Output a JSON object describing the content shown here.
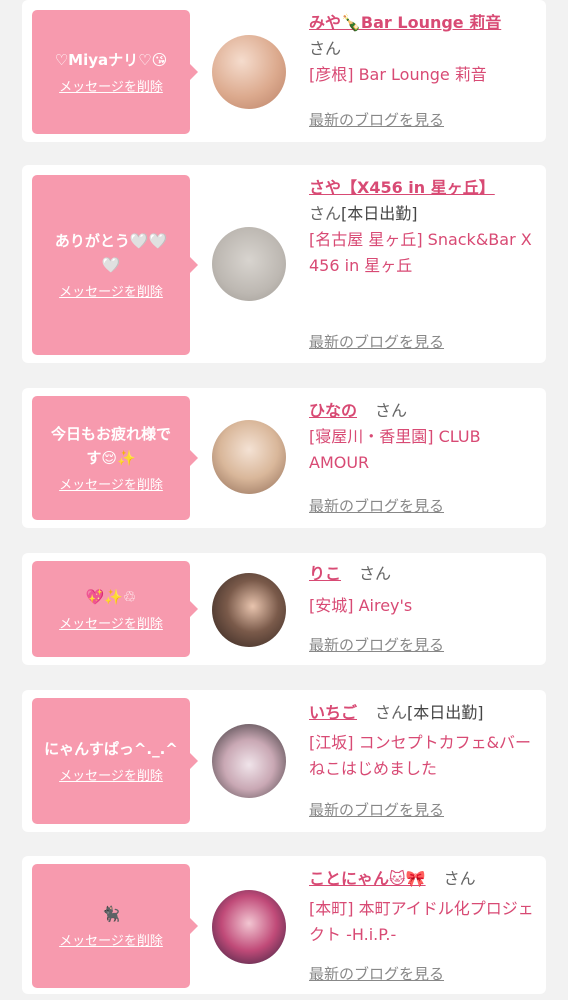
{
  "common": {
    "delete_label": "メッセージを削除",
    "blog_label": "最新のブログを見る",
    "san": "さん"
  },
  "messages": [
    {
      "bubble": "♡Miyaナリ♡😘",
      "name": "みや🍾Bar Lounge 莉音",
      "tag": "",
      "shop": "[彦根] Bar Lounge 莉音",
      "avatar_colors": [
        "#d8a48a",
        "#f1d3c3"
      ]
    },
    {
      "bubble": "ありがとう🤍🤍\n🤍",
      "name": "さや【X456 in 星ヶ丘】",
      "tag": "[本日出勤]",
      "shop": "[名古屋 星ヶ丘] Snack&Bar X 456 in 星ヶ丘",
      "avatar_colors": [
        "#cfcac4",
        "#a8a39d"
      ]
    },
    {
      "bubble": "今日もお疲れ様で\nす😌✨",
      "name": "ひなの",
      "tag": "",
      "shop": "[寝屋川・香里園] CLUB AMOUR",
      "avatar_colors": [
        "#e8cfb8",
        "#b98d6e"
      ]
    },
    {
      "bubble": "💖✨♲",
      "name": "りこ",
      "tag": "",
      "shop": "[安城] Airey's",
      "avatar_colors": [
        "#3a2a22",
        "#e1b9a0"
      ]
    },
    {
      "bubble": "にゃんすぱっ^._.^",
      "name": "いちご",
      "tag": "[本日出勤]",
      "shop": "[江坂] コンセプトカフェ&バー　ねこはじめました",
      "avatar_colors": [
        "#2e2b2e",
        "#e6d4dc"
      ]
    },
    {
      "bubble": "🐈‍⬛",
      "name": "ことにゃん🐱🎀",
      "tag": "",
      "shop": "[本町] 本町アイドル化プロジェクト -H.i.P.-",
      "avatar_colors": [
        "#2a1e3a",
        "#e05a8a"
      ]
    }
  ]
}
